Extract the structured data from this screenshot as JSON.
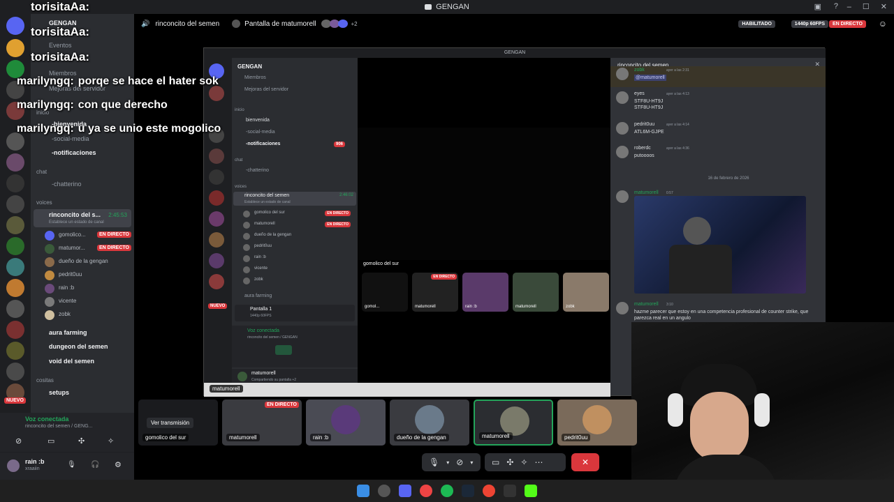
{
  "window": {
    "title": "GENGAN",
    "controls": [
      "–",
      "☐",
      "✕"
    ]
  },
  "overlay_chat": [
    {
      "user": "torisitaAa:",
      "text": ""
    },
    {
      "user": "torisitaAa:",
      "text": ""
    },
    {
      "user": "torisitaAa:",
      "text": ""
    },
    {
      "user": "marilyngq:",
      "text": "porqe se hace el hater sok"
    },
    {
      "user": "marilyngq:",
      "text": "con que derecho"
    },
    {
      "user": "marilyngq:",
      "text": "u ya se unio este mogolico"
    }
  ],
  "sidebar": {
    "server_name": "GENGAN",
    "items_top": [
      {
        "label": "Eventos"
      },
      {
        "label": "Miembros"
      },
      {
        "label": "Mejoras del servidor"
      }
    ],
    "cat_inicio": "inicio",
    "ch_bienvenida": "-bienvenida",
    "ch_social": "-social-media",
    "ch_notif": "-notificaciones",
    "cat_chat": "chat",
    "ch_chatterino": "-chatterino",
    "cat_voices": "voices",
    "voice_channel": "rinconcito del s...",
    "voice_time": "2:45:53",
    "voice_status": "Establece un estado de canal",
    "members": [
      {
        "name": "gomolico...",
        "live": "EN DIRECTO",
        "color": "#5865f2"
      },
      {
        "name": "matumor...",
        "live": "EN DIRECTO",
        "color": "#3a5a3a"
      },
      {
        "name": "dueño de la gengan",
        "live": "",
        "color": "#8a6a4a"
      },
      {
        "name": "pedrit0uu",
        "live": "",
        "color": "#c08a40"
      },
      {
        "name": "rain :b",
        "live": "",
        "color": "#6a4a7a"
      },
      {
        "name": "vicente",
        "live": "",
        "color": "#7a7a7a"
      },
      {
        "name": "zobk",
        "live": "",
        "color": "#d0c0a0"
      }
    ],
    "ch_aura": "aura farming",
    "ch_dungeon": "dungeon del semen",
    "ch_void": "void del semen",
    "cat_cositas": "cositas",
    "ch_setups": "setups",
    "nuevo": "NUEVO"
  },
  "voicebar": {
    "status": "Voz conectada",
    "sub": "rinconcito del semen / GENG..."
  },
  "userbar": {
    "name": "rain :b",
    "tag": "xraaiin"
  },
  "stage_header": {
    "channel": "rinconcito del semen",
    "screen": "Pantalla de matumorell",
    "plus": "+2",
    "enabled": "HABILITADO",
    "quality": "1440p 60FPS",
    "live": "EN DIRECTO"
  },
  "tiles": [
    {
      "label": "gomolico del sur",
      "btn": "Ver transmisión",
      "live": ""
    },
    {
      "label": "matumorell",
      "btn": "",
      "live": "EN DIRECTO"
    },
    {
      "label": "rain :b",
      "btn": "",
      "live": ""
    },
    {
      "label": "dueño de la gengan",
      "btn": "",
      "live": ""
    },
    {
      "label": "matumorell",
      "btn": "",
      "live": ""
    },
    {
      "label": "pedrit0uu",
      "btn": "",
      "live": ""
    }
  ],
  "inner": {
    "title": "GENGAN",
    "server": "GENGAN",
    "members_label": "Miembros",
    "boosts": "Mejoras del servidor",
    "cat_inicio": "inicio",
    "ch1": "bienvenida",
    "ch2": "-social-media",
    "ch3": "-notificaciones",
    "badge": "906",
    "cat_chat": "chat",
    "ch4": "-chatterino",
    "cat_voices": "voices",
    "voice": "rinconcito del semen",
    "voice_time": "2:46:02",
    "voice_status": "Establece un estado de canal",
    "members": [
      {
        "name": "gomolico del sur",
        "live": "EN DIRECTO"
      },
      {
        "name": "matumorell",
        "live": "EN DIRECTO"
      },
      {
        "name": "dueño de la gengan",
        "live": ""
      },
      {
        "name": "pedrit0uu",
        "live": ""
      },
      {
        "name": "rain :b",
        "live": ""
      },
      {
        "name": "vicente",
        "live": ""
      },
      {
        "name": "zobk",
        "live": ""
      }
    ],
    "aura": "aura farming",
    "screen1": "Pantalla 1",
    "screen1_sub": "1440p 60FPS",
    "vc": "Voz conectada",
    "vc_sub": "rinconcito del semen / GENGAN",
    "user": "matumorell",
    "user_sub": "Compartiendo su pantalla +2",
    "nuevo": "NUEVO",
    "stream_label": "gomolico del sur",
    "mini_tiles": [
      {
        "label": "gomol..."
      },
      {
        "label": "matumorell",
        "live": "EN DIRECTO"
      },
      {
        "label": "rain :b"
      },
      {
        "label": "matumorell"
      },
      {
        "label": "zobk"
      }
    ],
    "bottom_label": "matumorell"
  },
  "chat_panel": {
    "title": "rinconcito del semen",
    "date_divider": "16 de febrero de 2026",
    "messages": [
      {
        "user": "zobk",
        "time": "ayer a las 2:31",
        "text": "@matumorell",
        "color": "#23a55a"
      },
      {
        "user": "eyes",
        "time": "ayer a las 4:13",
        "text": "STF8U-HT9J",
        "text2": "STF8U-HT9J",
        "color": "#dbdee1"
      },
      {
        "user": "pedrit0uu",
        "time": "ayer a las 4:14",
        "text": "ATL6M-GJPE",
        "color": "#dbdee1"
      },
      {
        "user": "roberdc",
        "time": "ayer a las 4:36",
        "text": "putoooos",
        "color": "#dbdee1"
      },
      {
        "user": "matumorell",
        "time": "0:57",
        "text": "",
        "color": "#23a55a"
      },
      {
        "user": "matumorell",
        "time": "3:10",
        "text": "hazme parecer que estoy en una competencia profesional de counter strike, que parezca real en un angulo",
        "color": "#23a55a"
      }
    ]
  },
  "colors": {
    "live": "#da373c",
    "green": "#23a55a",
    "blurple": "#5865f2"
  }
}
